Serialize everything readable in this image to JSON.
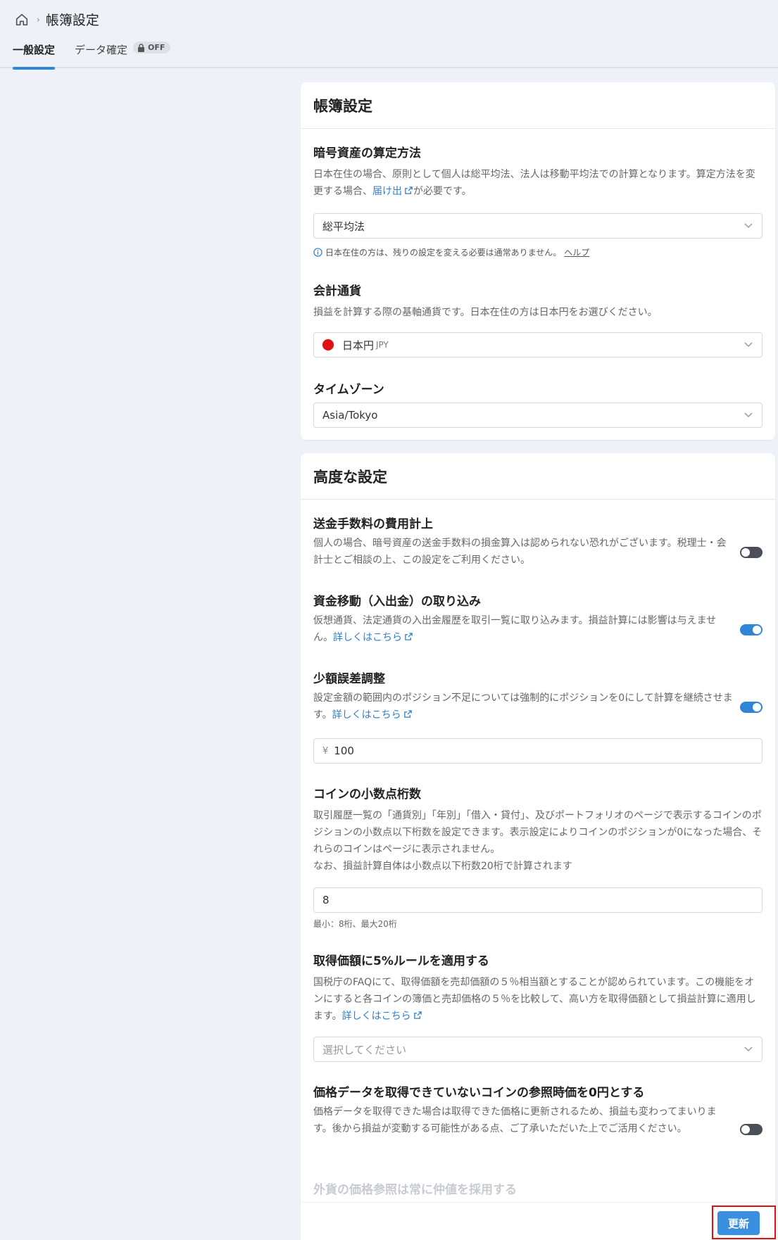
{
  "breadcrumb": {
    "title": "帳簿設定"
  },
  "tabs": [
    {
      "label": "一般設定",
      "active": true
    },
    {
      "label": "データ確定",
      "badge": "OFF"
    }
  ],
  "ledger_card": {
    "title": "帳簿設定",
    "calc_method": {
      "title": "暗号資産の算定方法",
      "desc_before": "日本在住の場合、原則として個人は総平均法、法人は移動平均法での計算となります。算定方法を変更する場合、",
      "link": "届け出",
      "desc_after": "が必要です。",
      "value": "総平均法",
      "note": "日本在住の方は、残りの設定を変える必要は通常ありません。",
      "note_link": "ヘルプ"
    },
    "currency": {
      "title": "会計通貨",
      "desc": "損益を計算する際の基軸通貨です。日本在住の方は日本円をお選びください。",
      "value": "日本円",
      "code": "JPY",
      "flag_color": "#d11111"
    },
    "timezone": {
      "title": "タイムゾーン",
      "value": "Asia/Tokyo"
    }
  },
  "advanced_card": {
    "title": "高度な設定",
    "fee": {
      "title": "送金手数料の費用計上",
      "desc": "個人の場合、暗号資産の送金手数料の損金算入は認められない恐れがございます。税理士・会計士とご相談の上、この設定をご利用ください。",
      "enabled": false
    },
    "transfer": {
      "title": "資金移動（入出金）の取り込み",
      "desc": "仮想通貨、法定通貨の入出金履歴を取引一覧に取り込みます。損益計算には影響は与えません。",
      "link": "詳しくはこちら",
      "enabled": true
    },
    "small_diff": {
      "title": "少額誤差調整",
      "desc": "設定金額の範囲内のポジション不足については強制的にポジションを0にして計算を継続させます。",
      "link": "詳しくはこちら",
      "enabled": true,
      "currency_symbol": "¥",
      "amount": "100"
    },
    "decimals": {
      "title": "コインの小数点桁数",
      "desc": "取引履歴一覧の「通貨別」「年別」「借入・貸付」、及びポートフォリオのページで表示するコインのポジションの小数点以下桁数を設定できます。表示設定によりコインのポジションが0になった場合、それらのコインはページに表示されません。",
      "desc2": "なお、損益計算自体は小数点以下桁数20桁で計算されます",
      "value": "8",
      "hint": "最小：8桁、最大20桁"
    },
    "five_percent": {
      "title": "取得価額に5%ルールを適用する",
      "desc": "国税庁のFAQにて、取得価額を売却価額の５％相当額とすることが認められています。この機能をオンにすると各コインの簿価と売却価格の５％を比較して、高い方を取得価額として損益計算に適用します。",
      "link": "詳しくはこちら",
      "placeholder": "選択してください"
    },
    "zero_price": {
      "title": "価格データを取得できていないコインの参照時価を0円とする",
      "desc": "価格データを取得できた場合は取得できた価格に更新されるため、損益も変わってまいります。後から損益が変動する可能性がある点、ご了承いただいた上でご活用ください。",
      "enabled": false
    },
    "fx_mid": {
      "title": "外貨の価格参照は常に仲値を採用する"
    }
  },
  "footer": {
    "update_label": "更新"
  }
}
